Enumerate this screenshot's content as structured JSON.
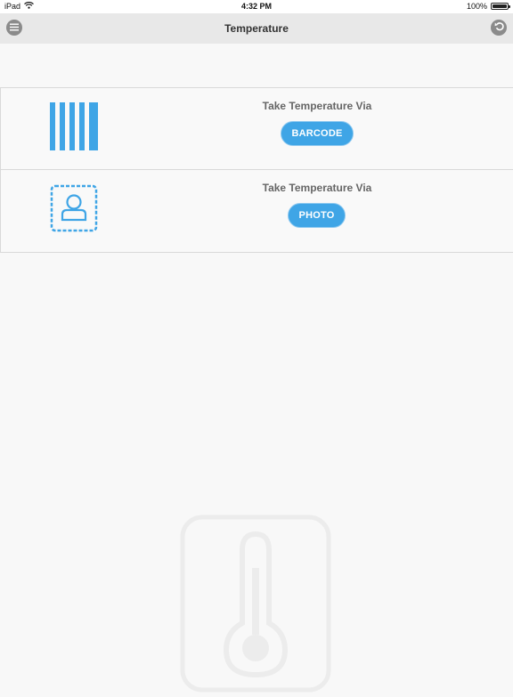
{
  "status_bar": {
    "device": "iPad",
    "time": "4:32 PM",
    "battery_percent": "100%",
    "battery_level": 1.0
  },
  "nav": {
    "title": "Temperature",
    "left_icon": "menu-icon",
    "right_icon": "back-icon"
  },
  "options": [
    {
      "icon": "barcode-icon",
      "label": "Take Temperature Via",
      "button": "BARCODE"
    },
    {
      "icon": "photo-icon",
      "label": "Take Temperature Via",
      "button": "PHOTO"
    }
  ],
  "colors": {
    "accent": "#3fa5e6",
    "nav_background": "#e8e8e8",
    "nav_button": "#8b8b8b",
    "background": "#f8f8f8"
  },
  "watermark_icon": "thermometer-icon"
}
